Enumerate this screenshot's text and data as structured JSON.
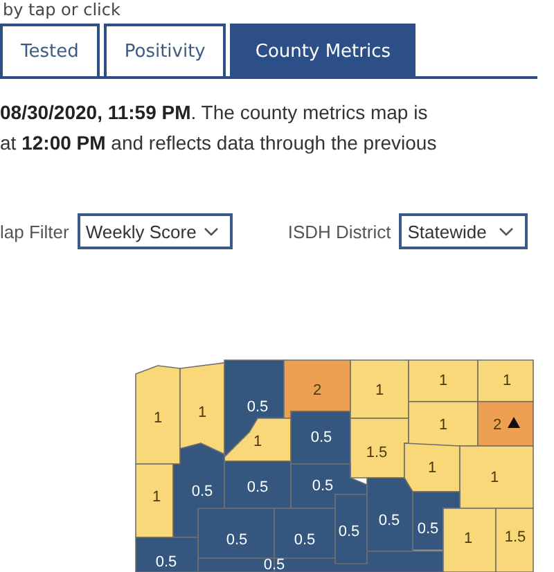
{
  "hint": "by tap or click",
  "tabs": [
    {
      "label": "Tested",
      "selected": false
    },
    {
      "label": "Positivity",
      "selected": false
    },
    {
      "label": "County Metrics",
      "selected": true
    }
  ],
  "notice": [
    "**08/30/2020, 11:59 PM**. The county metrics map is",
    "at **12:00 PM** and reflects data through the previous"
  ],
  "filters": [
    {
      "label": "lap Filter",
      "value": "Weekly Score"
    },
    {
      "label": "ISDH District",
      "value": "Statewide"
    }
  ],
  "map": {
    "counties": [
      {
        "label": "1",
        "color": "#f8d878"
      },
      {
        "label": "1",
        "color": "#f8d878"
      },
      {
        "label": "0.5",
        "color": "#34567f"
      },
      {
        "label": "2",
        "color": "#eda052"
      },
      {
        "label": "1",
        "color": "#f8d878"
      },
      {
        "label": "0.5",
        "color": "#34567f"
      },
      {
        "label": "1",
        "color": "#f8d878"
      },
      {
        "label": "1.5",
        "color": "#f8d878"
      },
      {
        "label": "1",
        "color": "#f8d878"
      },
      {
        "label": "1",
        "color": "#f8d878"
      },
      {
        "label": "1",
        "color": "#f8d878"
      },
      {
        "label": "2",
        "color": "#eda052",
        "alert": true
      },
      {
        "label": "1",
        "color": "#f8d878"
      },
      {
        "label": "1",
        "color": "#f8d878"
      },
      {
        "label": "1",
        "color": "#f8d878"
      },
      {
        "label": "0.5",
        "color": "#34567f"
      },
      {
        "label": "0.5",
        "color": "#34567f"
      },
      {
        "label": "0.5",
        "color": "#34567f"
      },
      {
        "label": "0.5",
        "color": "#34567f"
      },
      {
        "label": "0.5",
        "color": "#34567f"
      },
      {
        "label": "0.5",
        "color": "#34567f"
      },
      {
        "label": "0.5",
        "color": "#34567f"
      },
      {
        "label": "0.5",
        "color": "#34567f"
      },
      {
        "label": "1",
        "color": "#f8d878"
      },
      {
        "label": "1.5",
        "color": "#f8d878"
      },
      {
        "label": "0.5",
        "color": "#34567f"
      },
      {
        "label": "0.5",
        "color": "#34567f"
      }
    ]
  }
}
